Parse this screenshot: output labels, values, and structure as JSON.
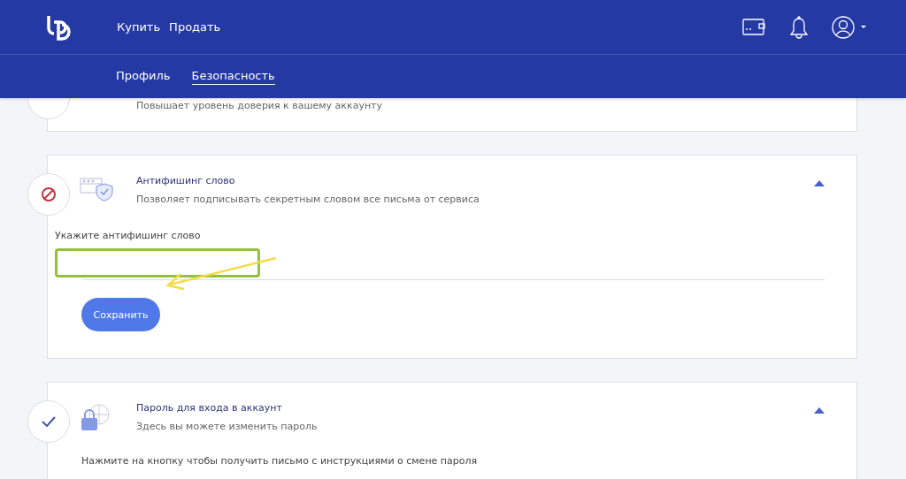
{
  "header": {
    "nav": [
      {
        "label": "Купить"
      },
      {
        "label": "Продать"
      }
    ],
    "subnav": [
      {
        "label": "Профиль",
        "selected": false
      },
      {
        "label": "Безопасность",
        "selected": true
      }
    ]
  },
  "sections": [
    {
      "description": "Повышает уровень доверия к вашему аккаунту",
      "kind": "partial",
      "expanded": false
    },
    {
      "title": "Антифишинг слово",
      "description": "Позволяет подписывать секретным словом все письма от сервиса",
      "kind": "blocked",
      "expanded": true,
      "field_label": "Укажите антифишинг слово",
      "field_highlighted": true,
      "button": "Сохранить",
      "annotated": true
    },
    {
      "title": "Пароль для входа в аккаунт",
      "description": "Здесь вы можете изменить пароль",
      "kind": "done",
      "expanded": true,
      "body_text": "Нажмите на кнопку чтобы получить письмо с инструкциями о смене пароля"
    }
  ]
}
